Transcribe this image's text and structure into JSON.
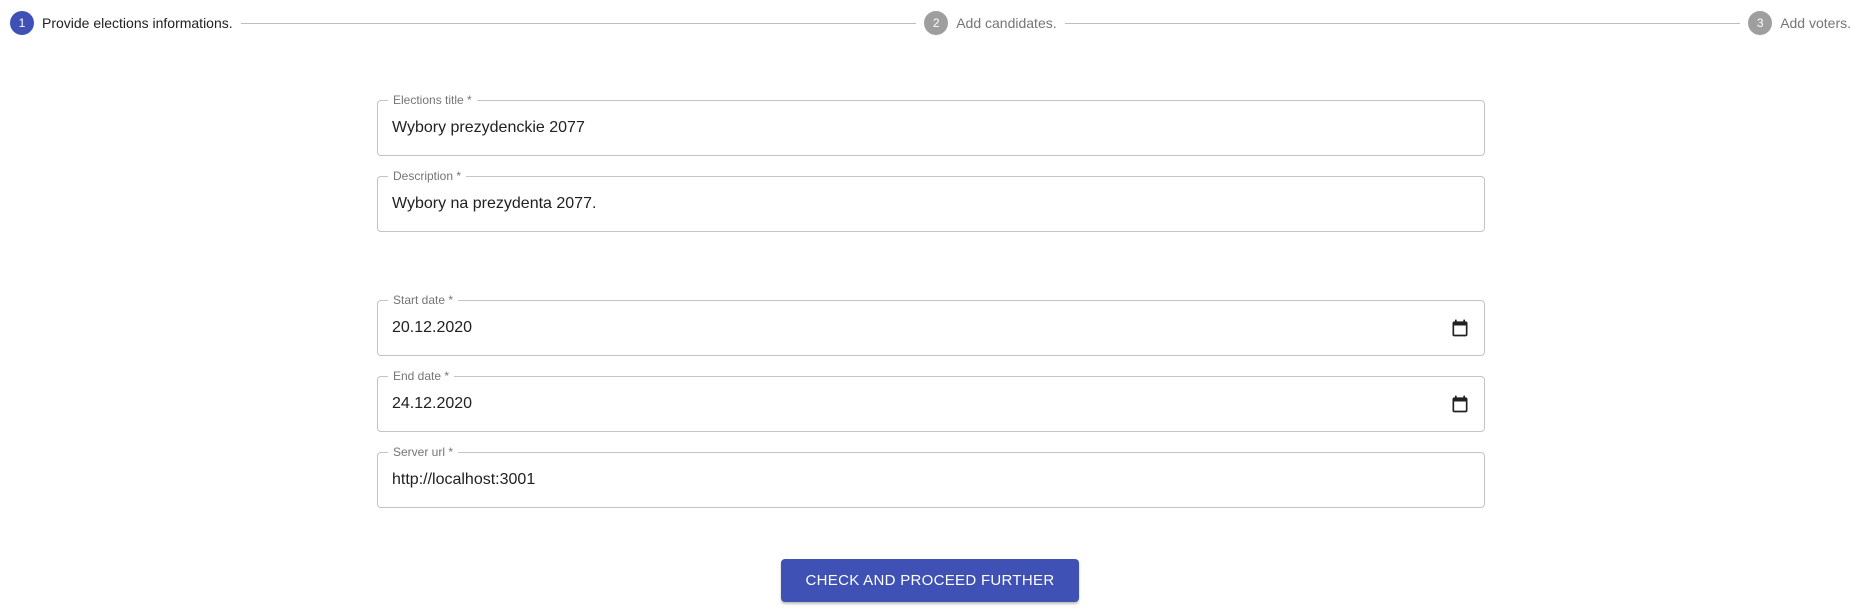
{
  "stepper": {
    "steps": [
      {
        "number": "1",
        "label": "Provide elections informations.",
        "state": "active"
      },
      {
        "number": "2",
        "label": "Add candidates.",
        "state": "inactive"
      },
      {
        "number": "3",
        "label": "Add voters.",
        "state": "inactive"
      }
    ]
  },
  "form": {
    "title": {
      "label": "Elections title *",
      "value": "Wybory prezydenckie 2077"
    },
    "description": {
      "label": "Description *",
      "value": "Wybory na prezydenta 2077."
    },
    "start_date": {
      "label": "Start date *",
      "value": "20.12.2020",
      "icon": "calendar-icon"
    },
    "end_date": {
      "label": "End date *",
      "value": "24.12.2020",
      "icon": "calendar-icon"
    },
    "server_url": {
      "label": "Server url *",
      "value": "http://localhost:3001"
    }
  },
  "submit_button": {
    "label": "CHECK AND PROCEED FURTHER"
  },
  "colors": {
    "primary": "#3f51b5",
    "inactive_step": "#9e9e9e",
    "border": "#c4c4c4"
  }
}
